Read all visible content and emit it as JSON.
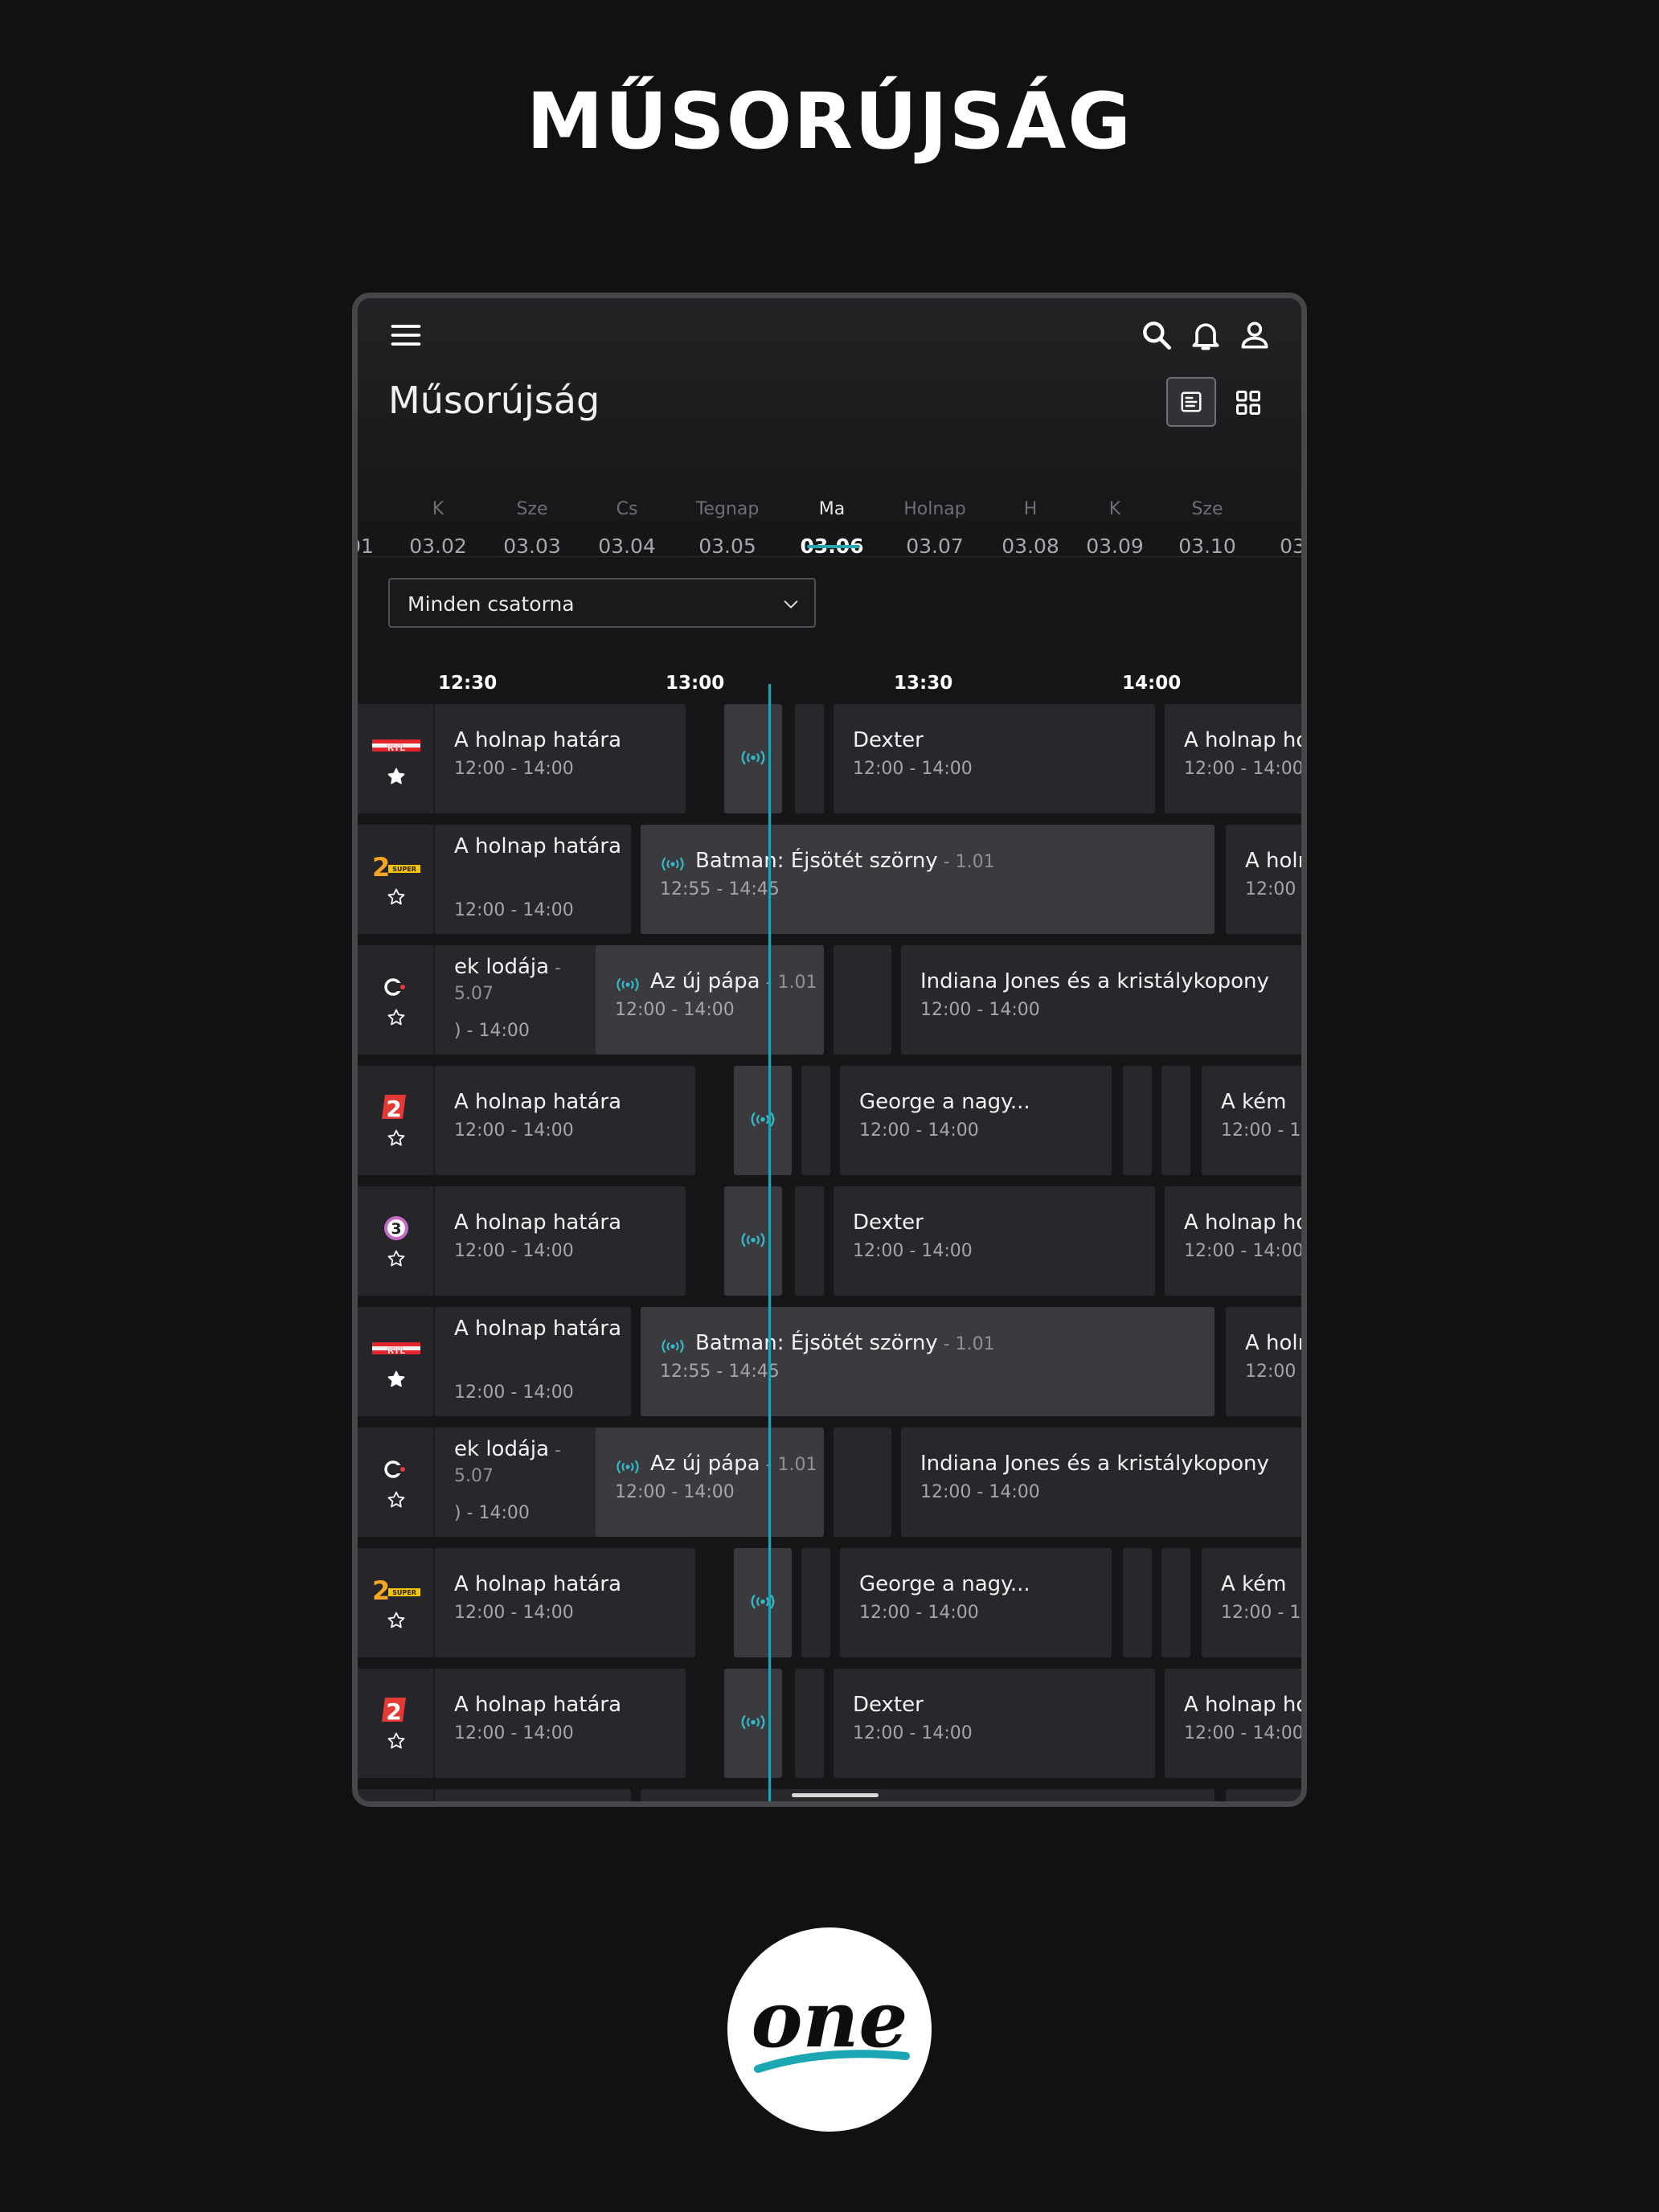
{
  "headline": "MŰSORÚJSÁG",
  "app": {
    "title": "Műsorújság",
    "icons": {
      "menu": "menu-icon",
      "search": "search-icon",
      "notifications": "bell-icon",
      "profile": "person-icon",
      "list_view": "list-view-icon",
      "grid_view": "grid-view-icon"
    },
    "accent_color": "#2aa3b0"
  },
  "dates": [
    {
      "dow": "",
      "date": "01"
    },
    {
      "dow": "K",
      "date": "03.02"
    },
    {
      "dow": "Sze",
      "date": "03.03"
    },
    {
      "dow": "Cs",
      "date": "03.04"
    },
    {
      "dow": "Tegnap",
      "date": "03.05"
    },
    {
      "dow": "Ma",
      "date": "03.06"
    },
    {
      "dow": "Holnap",
      "date": "03.07"
    },
    {
      "dow": "H",
      "date": "03.08"
    },
    {
      "dow": "K",
      "date": "03.09"
    },
    {
      "dow": "Sze",
      "date": "03.10"
    },
    {
      "dow": "",
      "date": "03"
    }
  ],
  "selected_date": "03.06",
  "channel_filter": {
    "value": "Minden csatorna"
  },
  "timeline": [
    "12:30",
    "13:00",
    "13:30",
    "14:00"
  ],
  "rows": [
    {
      "channel": "RTL",
      "favorite": true,
      "programs": [
        {
          "title": "A holnap határa",
          "time": "12:00 - 14:00"
        },
        {
          "live_only": true
        },
        {
          "empty": true
        },
        {
          "title": "Dexter",
          "time": "12:00 - 14:00"
        },
        {
          "title": "A holnap ho",
          "time": "12:00 - 14:00"
        }
      ]
    },
    {
      "channel": "Super TV2",
      "favorite": false,
      "programs": [
        {
          "title": "A holnap határa",
          "time": "12:00 - 14:00"
        },
        {
          "title": "Batman: Éjsötét szörny",
          "episode": " - 1.01",
          "time": "12:55 - 14:45",
          "live": true
        },
        {
          "title": "A holn",
          "time": "12:00"
        }
      ]
    },
    {
      "channel": "Cool",
      "favorite": false,
      "programs": [
        {
          "title": "ek lodája",
          "episode": " - 5.07",
          "time": ") - 14:00"
        },
        {
          "title": "Az új pápa",
          "episode": " - 1.01",
          "time": "12:00 - 14:00",
          "live": true
        },
        {
          "empty": true
        },
        {
          "title": "Indiana Jones és a kristálykopony",
          "time": "12:00 - 14:00"
        }
      ]
    },
    {
      "channel": "TV2",
      "favorite": false,
      "programs": [
        {
          "title": "A holnap határa",
          "time": "12:00 - 14:00"
        },
        {
          "live_only": true
        },
        {
          "empty": true
        },
        {
          "title": "George a nagy...",
          "time": "12:00 - 14:00"
        },
        {
          "empty": true
        },
        {
          "empty": true
        },
        {
          "title": "A kém",
          "time": "12:00 - 1"
        }
      ]
    },
    {
      "channel": "Film3",
      "favorite": false,
      "programs": [
        {
          "title": "A holnap határa",
          "time": "12:00 - 14:00"
        },
        {
          "live_only": true
        },
        {
          "empty": true
        },
        {
          "title": "Dexter",
          "time": "12:00 - 14:00"
        },
        {
          "title": "A holnap ho",
          "time": "12:00 - 14:00"
        }
      ]
    },
    {
      "channel": "RTL",
      "favorite": true,
      "programs": [
        {
          "title": "A holnap határa",
          "time": "12:00 - 14:00"
        },
        {
          "title": "Batman: Éjsötét szörny",
          "episode": " - 1.01",
          "time": "12:55 - 14:45",
          "live": true
        },
        {
          "title": "A holn",
          "time": "12:00"
        }
      ]
    },
    {
      "channel": "Cool",
      "favorite": false,
      "programs": [
        {
          "title": "ek lodája",
          "episode": " - 5.07",
          "time": ") - 14:00"
        },
        {
          "title": "Az új pápa",
          "episode": " - 1.01",
          "time": "12:00 - 14:00",
          "live": true
        },
        {
          "empty": true
        },
        {
          "title": "Indiana Jones és a kristálykopony",
          "time": "12:00 - 14:00"
        }
      ]
    },
    {
      "channel": "Super TV2",
      "favorite": false,
      "programs": [
        {
          "title": "A holnap határa",
          "time": "12:00 - 14:00"
        },
        {
          "live_only": true
        },
        {
          "empty": true
        },
        {
          "title": "George a nagy...",
          "time": "12:00 - 14:00"
        },
        {
          "empty": true
        },
        {
          "empty": true
        },
        {
          "title": "A kém",
          "time": "12:00 - 1"
        }
      ]
    },
    {
      "channel": "TV2",
      "favorite": false,
      "programs": [
        {
          "title": "A holnap határa",
          "time": "12:00 - 14:00"
        },
        {
          "live_only": true
        },
        {
          "empty": true
        },
        {
          "title": "Dexter",
          "time": "12:00 - 14:00"
        },
        {
          "title": "A holnap ho",
          "time": "12:00 - 14:00"
        }
      ]
    }
  ],
  "brand": {
    "logo": "one"
  }
}
